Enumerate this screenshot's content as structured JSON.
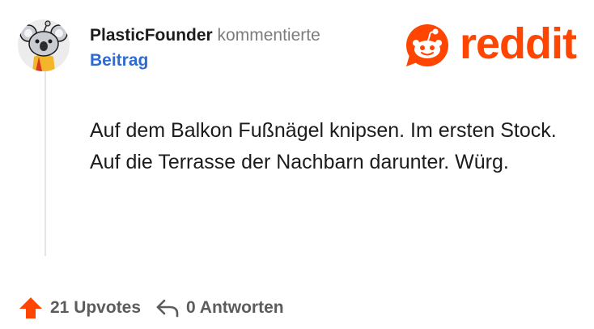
{
  "comment": {
    "author": "PlasticFounder",
    "action": "kommentierte",
    "target": "Beitrag",
    "body": "Auf dem Balkon Fußnägel knipsen. Im ersten Stock. Auf die Terrasse der Nachbarn darunter. Würg."
  },
  "brand": {
    "name": "reddit",
    "color": "#ff4500"
  },
  "footer": {
    "upvotes": "21 Upvotes",
    "replies": "0 Antworten"
  },
  "icons": {
    "avatar": "snoo-koala-avatar",
    "brand": "reddit-snoo-icon",
    "upvote": "upvote-arrow-icon",
    "reply": "reply-arrow-icon"
  },
  "colors": {
    "link": "#2d6bd3",
    "upvote": "#ff4500",
    "muted": "#7c7c7c"
  }
}
